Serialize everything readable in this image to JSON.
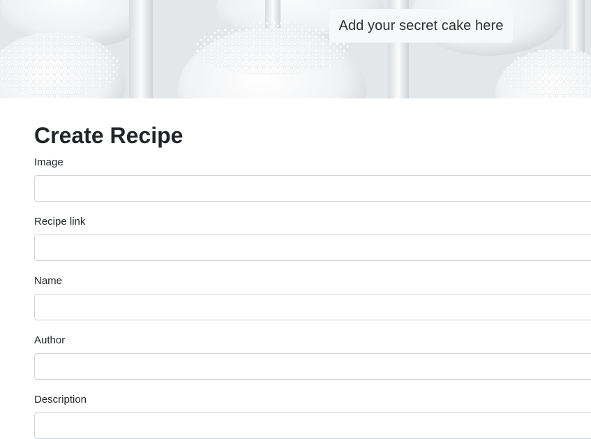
{
  "hero": {
    "tagline": "Add your secret cake here"
  },
  "form": {
    "title": "Create Recipe",
    "fields": [
      {
        "label": "Image",
        "value": "",
        "placeholder": ""
      },
      {
        "label": "Recipe link",
        "value": "",
        "placeholder": ""
      },
      {
        "label": "Name",
        "value": "",
        "placeholder": ""
      },
      {
        "label": "Author",
        "value": "",
        "placeholder": ""
      },
      {
        "label": "Description",
        "value": "",
        "placeholder": ""
      }
    ]
  },
  "colors": {
    "input_border": "#ced4da",
    "text": "#212529",
    "hero_tag_bg": "#f7f8f9"
  }
}
